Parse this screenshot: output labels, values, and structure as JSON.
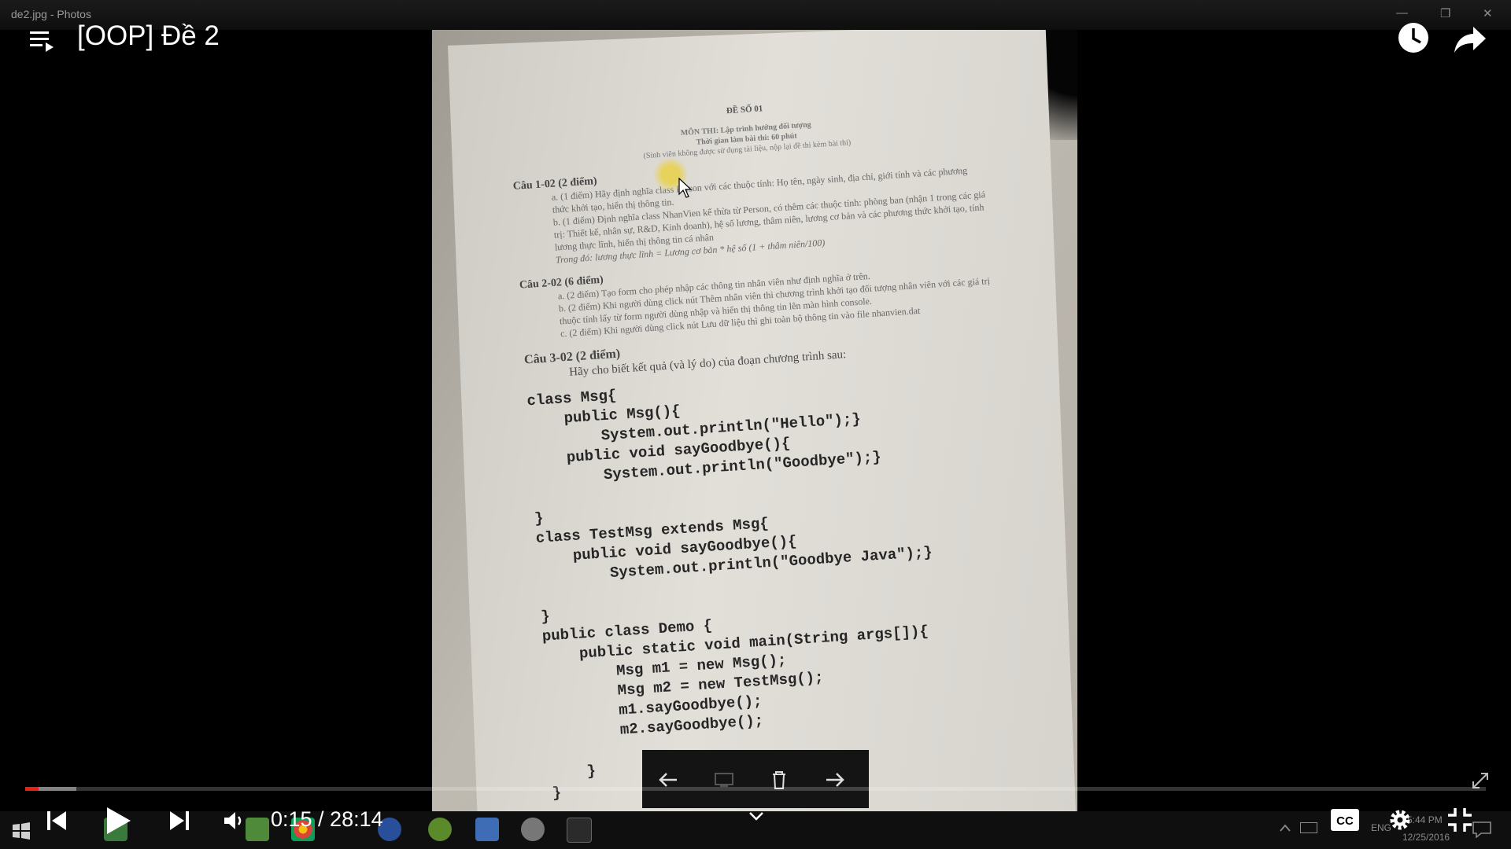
{
  "window": {
    "app_title": "de2.jpg - Photos"
  },
  "video": {
    "title": "[OOP] Đề 2",
    "current_time": "0:15",
    "duration": "28:14",
    "time_display": "0:15 / 28:14",
    "progress_fraction": 0.009,
    "buffered_fraction": 0.035
  },
  "colors": {
    "progress": "#e62117",
    "cursor_highlight": "#e7d25c"
  },
  "document": {
    "header": "ĐỀ SỐ 01",
    "subject": "MÔN THI: Lập trình hướng đối tượng",
    "duration_line": "Thời gian làm bài thi: 60 phút",
    "note": "(Sinh viên không được sử dụng tài liệu, nộp lại đề thi kèm bài thi)",
    "q1": "Câu 1-02 (2 điểm)",
    "q1a": "a. (1 điểm) Hãy định nghĩa class Person với các thuộc tính: Họ tên, ngày sinh, địa chỉ, giới tính và các phương thức khởi tạo, hiển thị thông tin.",
    "q1b": "b. (1 điểm) Định nghĩa class NhanVien kế thừa từ Person, có thêm các thuộc tính: phòng ban (nhận 1 trong các giá trị: Thiết kế, nhân sự, R&D, Kinh doanh), hệ số lương, thâm niên, lương cơ bản và các phương thức khởi tạo, tính lương thực lĩnh, hiển thị thông tin cá nhân",
    "q1c": "Trong đó: lương thực lĩnh = Lương cơ bản * hệ số (1 + thâm niên/100)",
    "q2": "Câu 2-02 (6 điểm)",
    "q2a": "a. (2 điểm) Tạo form cho phép nhập các thông tin nhân viên như định nghĩa ở trên.",
    "q2b": "b. (2 điểm) Khi người dùng click nút Thêm nhân viên thì chương trình khởi tạo đối tượng nhân viên với các giá trị thuộc tính lấy từ form người dùng nhập và hiển thị thông tin lên màn hình console.",
    "q2c": "c. (2 điểm) Khi người dùng click nút Lưu dữ liệu thì ghi toàn bộ thông tin vào file nhanvien.dat",
    "q3": "Câu 3-02 (2 điểm)",
    "q3_prompt": "Hãy cho biết kết quả (và lý do) của đoạn chương trình sau:",
    "code": "class Msg{\n    public Msg(){\n        System.out.println(\"Hello\");}\n    public void sayGoodbye(){\n        System.out.println(\"Goodbye\");}\n\n}\nclass TestMsg extends Msg{\n    public void sayGoodbye(){\n        System.out.println(\"Goodbye Java\");}\n\n}\npublic class Demo {\n    public static void main(String args[]){\n        Msg m1 = new Msg();\n        Msg m2 = new TestMsg();\n        m1.sayGoodbye();\n        m2.sayGoodbye();\n\n    }\n}"
  },
  "tray": {
    "lang": "ENG",
    "time": "5:44 PM",
    "date": "12/25/2016"
  }
}
